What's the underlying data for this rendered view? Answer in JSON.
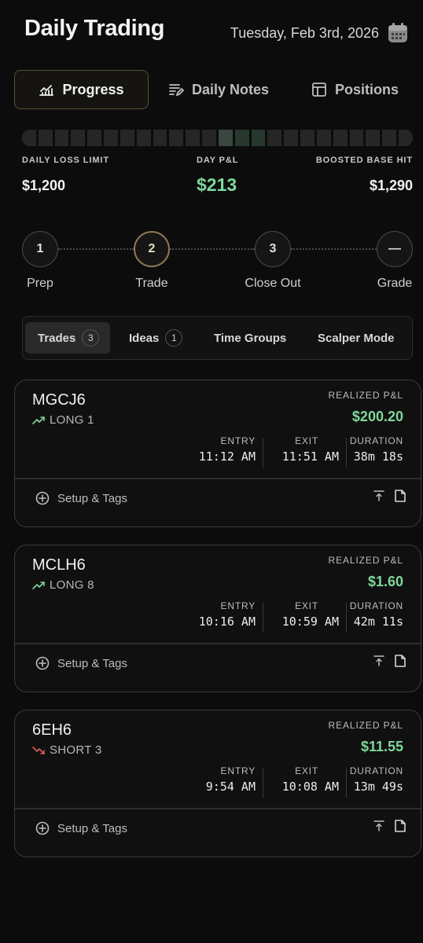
{
  "header": {
    "title": "Daily Trading",
    "date": "Tuesday, Feb 3rd, 2026",
    "calendar_icon": "calendar-icon"
  },
  "main_tabs": [
    {
      "label": "Progress",
      "icon": "chart-line-icon",
      "active": true
    },
    {
      "label": "Daily Notes",
      "icon": "notes-pen-icon",
      "active": false
    },
    {
      "label": "Positions",
      "icon": "layout-table-icon",
      "active": false
    }
  ],
  "progress": {
    "segments": 24,
    "highlight": [
      12,
      13,
      14
    ]
  },
  "stats": {
    "daily_loss_limit": {
      "label": "DAILY LOSS LIMIT",
      "value": "$1,200"
    },
    "day_pnl": {
      "label": "DAY P&L",
      "value": "$213"
    },
    "boosted_base_hit": {
      "label": "BOOSTED BASE HIT",
      "value": "$1,290"
    }
  },
  "steps": [
    {
      "number": "1",
      "label": "Prep",
      "active": false
    },
    {
      "number": "2",
      "label": "Trade",
      "active": true
    },
    {
      "number": "3",
      "label": "Close Out",
      "active": false
    },
    {
      "number": "—",
      "label": "Grade",
      "active": false
    }
  ],
  "sub_tabs": [
    {
      "label": "Trades",
      "badge": "3",
      "active": true
    },
    {
      "label": "Ideas",
      "badge": "1",
      "active": false
    },
    {
      "label": "Time Groups",
      "badge": null,
      "active": false
    },
    {
      "label": "Scalper Mode",
      "badge": null,
      "active": false
    }
  ],
  "trades": [
    {
      "symbol": "MGCJ6",
      "direction": "long",
      "side": "LONG 1",
      "realized_label": "REALIZED P&L",
      "realized": "$200.20",
      "entry_label": "ENTRY",
      "entry": "11:12 AM",
      "exit_label": "EXIT",
      "exit": "11:51 AM",
      "duration_label": "DURATION",
      "duration": "38m 18s",
      "setup_label": "Setup & Tags"
    },
    {
      "symbol": "MCLH6",
      "direction": "long",
      "side": "LONG 8",
      "realized_label": "REALIZED P&L",
      "realized": "$1.60",
      "entry_label": "ENTRY",
      "entry": "10:16 AM",
      "exit_label": "EXIT",
      "exit": "10:59 AM",
      "duration_label": "DURATION",
      "duration": "42m 11s",
      "setup_label": "Setup & Tags"
    },
    {
      "symbol": "6EH6",
      "direction": "short",
      "side": "SHORT 3",
      "realized_label": "REALIZED P&L",
      "realized": "$11.55",
      "entry_label": "ENTRY",
      "entry": "9:54 AM",
      "exit_label": "EXIT",
      "exit": "10:08 AM",
      "duration_label": "DURATION",
      "duration": "13m 49s",
      "setup_label": "Setup & Tags"
    }
  ],
  "colors": {
    "green": "#7fd79a",
    "red": "#e05a5a",
    "accent_gold": "#8d7a52"
  }
}
